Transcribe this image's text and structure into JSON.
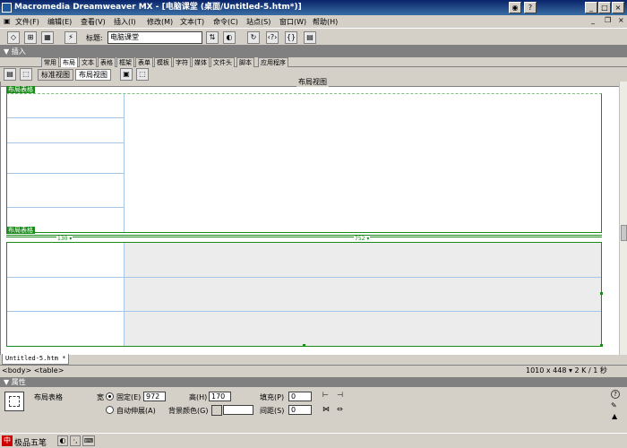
{
  "window": {
    "title": "Macromedia Dreamweaver MX - [电脑课堂 (桌面/Untitled-5.htm*)]"
  },
  "menu": [
    "文件(F)",
    "编辑(E)",
    "查看(V)",
    "插入(I)",
    "修改(M)",
    "文本(T)",
    "命令(C)",
    "站点(S)",
    "窗口(W)",
    "帮助(H)"
  ],
  "toolbar": {
    "title_label": "标题:",
    "title_value": "电脑课堂"
  },
  "insert_panel": {
    "label": "▼ 插入"
  },
  "insert_tabs": [
    "常用",
    "布局",
    "文本",
    "表格",
    "框架",
    "表单",
    "模板",
    "字符",
    "媒体",
    "文件头",
    "脚本",
    "应用程序"
  ],
  "view": {
    "standard": "标准视图",
    "layout": "布局视图",
    "center_label": "布局视图"
  },
  "doc": {
    "table_label_1": "布局表格",
    "table_label_2": "布局表格",
    "col1_width": "130 ▾",
    "col2_width": "752 ▾"
  },
  "doc_tab": "Untitled-5.htm *",
  "status": {
    "tags": "<body> <table>",
    "info": "1010 x 448 ▾ 2 K / 1 秒"
  },
  "props_panel": {
    "header": "▼ 属性"
  },
  "props": {
    "name": "布局表格",
    "width_label": "宽",
    "fixed_label": "固定(E)",
    "width_value": "972",
    "height_label": "高(H)",
    "height_value": "170",
    "padding_label": "填充(P)",
    "padding_value": "0",
    "autostretch_label": "自动伸展(A)",
    "bgcolor_label": "背景颜色(G)",
    "spacing_label": "间距(S)",
    "spacing_value": "0"
  },
  "taskbar": {
    "ime": "极品五笔"
  }
}
